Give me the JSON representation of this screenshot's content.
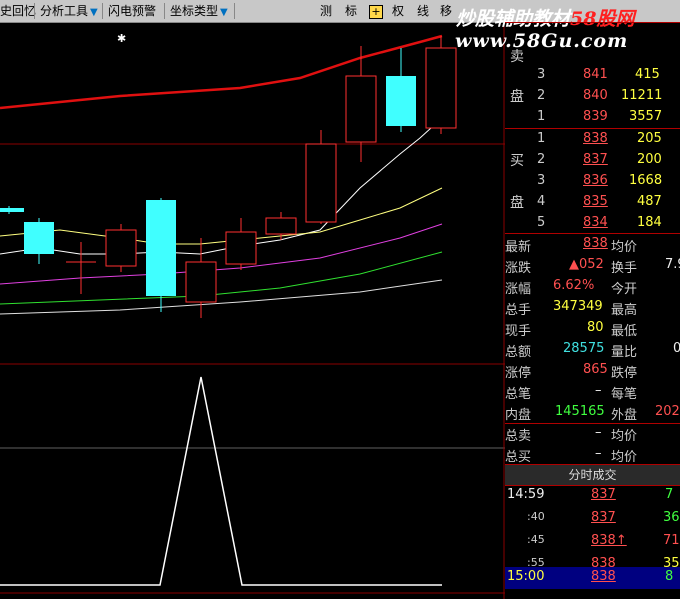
{
  "toolbar": {
    "history": "史回忆",
    "analysis_tools": "分析工具",
    "flash_alert": "闪电预警",
    "coord_type": "坐标类型",
    "btn_measure": "测",
    "btn_mark": "标",
    "btn_plus": "+",
    "btn_weight": "权",
    "btn_line": "线",
    "btn_move": "移"
  },
  "watermark": {
    "text_white": "炒股辅助教材",
    "text_red": "58股网",
    "url": "www.58Gu.com"
  },
  "order_book": {
    "sell_label_top": "卖",
    "sell_label_bottom": "盘",
    "buy_label_top": "买",
    "buy_label_bottom": "盘",
    "sells": [
      {
        "level": "3",
        "price": "841",
        "volume": "415"
      },
      {
        "level": "2",
        "price": "840",
        "volume": "11211"
      },
      {
        "level": "1",
        "price": "839",
        "volume": "3557"
      }
    ],
    "buys": [
      {
        "level": "1",
        "price": "838",
        "volume": "205"
      },
      {
        "level": "2",
        "price": "837",
        "volume": "200"
      },
      {
        "level": "3",
        "price": "836",
        "volume": "1668"
      },
      {
        "level": "4",
        "price": "835",
        "volume": "487"
      },
      {
        "level": "5",
        "price": "834",
        "volume": "184"
      }
    ]
  },
  "quote": {
    "latest_label": "最新",
    "latest": "838",
    "avg_label": "均价",
    "change_label": "涨跌",
    "change": "▲052",
    "turnover_label": "换手",
    "turnover": "7.9",
    "pct_label": "涨幅",
    "pct": "6.62%",
    "open_label": "今开",
    "total_hand_label": "总手",
    "total_hand": "347349",
    "high_label": "最高",
    "cur_hand_label": "现手",
    "cur_hand": "80",
    "low_label": "最低",
    "amount_label": "总额",
    "amount": "28575",
    "ratio_label": "量比",
    "limit_up_label": "涨停",
    "limit_up": "865",
    "limit_down_label": "跌停",
    "total_deals_label": "总笔",
    "total_deals": "–",
    "per_deal_label": "每笔",
    "inner_label": "内盘",
    "inner": "145165",
    "outer_label": "外盘",
    "outer": "202",
    "total_sell_label": "总卖",
    "total_sell": "–",
    "avg2_label": "均价",
    "total_buy_label": "总买",
    "total_buy": "–",
    "avg3_label": "均价"
  },
  "trades": {
    "title": "分时成交",
    "rows": [
      {
        "time": "14:59",
        "price": "837",
        "vol": "7"
      },
      {
        "time": ":40",
        "price": "837",
        "vol": "36"
      },
      {
        "time": ":45",
        "price": "838↑",
        "vol": "71"
      },
      {
        "time": ":55",
        "price": "838",
        "vol": "35"
      },
      {
        "time": "15:00",
        "price": "838",
        "vol": "8"
      }
    ]
  },
  "colors": {
    "ma_red": "#e01010",
    "up": "#ff3030",
    "down": "#40ffff",
    "ma_white": "#ffffff",
    "ma_yellow": "#ffff80",
    "ma_purple": "#e040e0",
    "ma_green": "#30e030",
    "grid": "#8a0000"
  }
}
